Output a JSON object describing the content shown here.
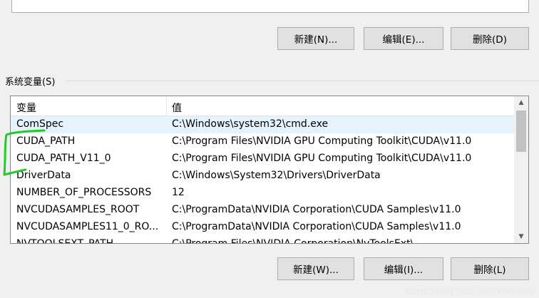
{
  "user_vars_buttons": {
    "new": "新建(N)...",
    "edit": "编辑(E)...",
    "delete": "删除(D)"
  },
  "system_vars": {
    "section_label": "系统变量(S)",
    "columns": {
      "name": "变量",
      "value": "值"
    },
    "rows": [
      {
        "name": "ComSpec",
        "value": "C:\\Windows\\system32\\cmd.exe"
      },
      {
        "name": "CUDA_PATH",
        "value": "C:\\Program Files\\NVIDIA GPU Computing Toolkit\\CUDA\\v11.0"
      },
      {
        "name": "CUDA_PATH_V11_0",
        "value": "C:\\Program Files\\NVIDIA GPU Computing Toolkit\\CUDA\\v11.0"
      },
      {
        "name": "DriverData",
        "value": "C:\\Windows\\System32\\Drivers\\DriverData"
      },
      {
        "name": "NUMBER_OF_PROCESSORS",
        "value": "12"
      },
      {
        "name": "NVCUDASAMPLES_ROOT",
        "value": "C:\\ProgramData\\NVIDIA Corporation\\CUDA Samples\\v11.0"
      },
      {
        "name": "NVCUDASAMPLES11_0_RO...",
        "value": "C:\\ProgramData\\NVIDIA Corporation\\CUDA Samples\\v11.0"
      },
      {
        "name": "NVTOOLSEXT_PATH",
        "value": "C:\\Program Files\\NVIDIA Corporation\\NvToolsExt\\"
      }
    ],
    "selected_row": "ComSpec",
    "scroll_icons": {
      "up": "scroll-up-arrow",
      "down": "scroll-down-arrow"
    }
  },
  "system_vars_buttons": {
    "new": "新建(W)...",
    "edit": "编辑(I)...",
    "delete": "删除(L)"
  },
  "annotation_color": "#22cc22",
  "watermark": "https://blog.csdn.net/xxxxxbai"
}
